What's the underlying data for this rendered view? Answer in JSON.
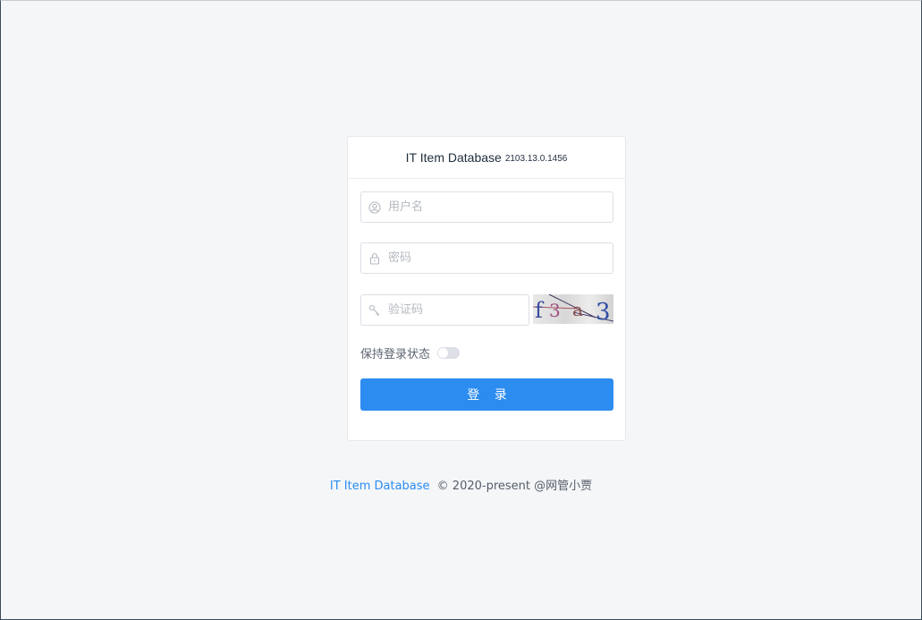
{
  "header": {
    "title": "IT Item Database",
    "version": "2103.13.0.1456"
  },
  "form": {
    "username_placeholder": "用户名",
    "password_placeholder": "密码",
    "captcha_placeholder": "验证码",
    "captcha_text": "f3a 3",
    "remember_label": "保持登录状态",
    "remember_on": false,
    "login_label": "登 录"
  },
  "footer": {
    "link_text": "IT Item Database",
    "copyright": "© 2020-present @网管小贾"
  },
  "colors": {
    "primary": "#2d8cf0",
    "background": "#f4f6f8"
  },
  "icons": {
    "username": "user-icon",
    "password": "lock-icon",
    "captcha": "key-icon"
  }
}
